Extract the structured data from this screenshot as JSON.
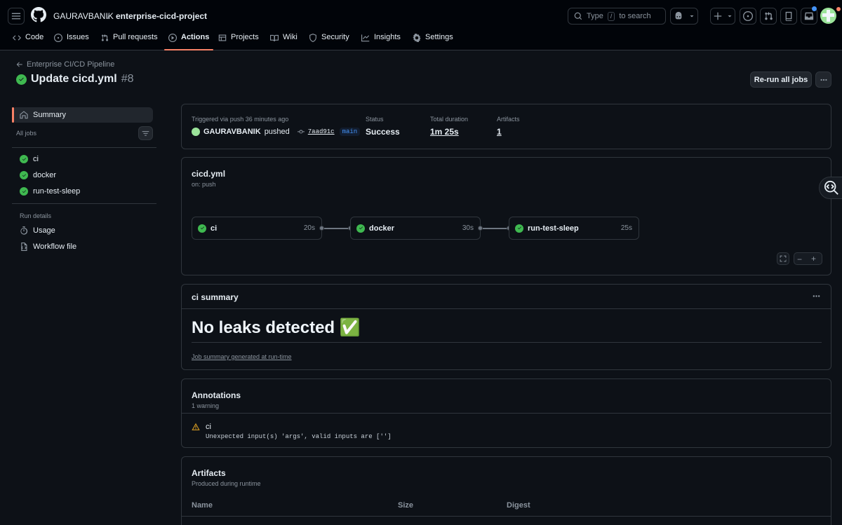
{
  "header": {
    "owner": "GAURAVBANIK",
    "separator": "/",
    "repo": "enterprise-cicd-project",
    "search_type": "Type",
    "search_key": "/",
    "search_rest": "to search"
  },
  "tabs": [
    {
      "label": "Code",
      "icon": "code-icon"
    },
    {
      "label": "Issues",
      "icon": "issue-icon"
    },
    {
      "label": "Pull requests",
      "icon": "pull-request-icon"
    },
    {
      "label": "Actions",
      "icon": "play-icon",
      "active": true
    },
    {
      "label": "Projects",
      "icon": "table-icon"
    },
    {
      "label": "Wiki",
      "icon": "book-icon"
    },
    {
      "label": "Security",
      "icon": "shield-icon"
    },
    {
      "label": "Insights",
      "icon": "graph-icon"
    },
    {
      "label": "Settings",
      "icon": "gear-icon"
    }
  ],
  "run": {
    "back_label": "Enterprise CI/CD Pipeline",
    "title": "Update cicd.yml",
    "number": "#8",
    "rerun_label": "Re-run all jobs"
  },
  "sidebar": {
    "summary_label": "Summary",
    "all_jobs_label": "All jobs",
    "jobs": [
      "ci",
      "docker",
      "run-test-sleep"
    ],
    "run_details_label": "Run details",
    "details": [
      {
        "label": "Usage",
        "icon": "stopwatch-icon"
      },
      {
        "label": "Workflow file",
        "icon": "file-icon"
      }
    ]
  },
  "summary": {
    "trigger_text": "Triggered via push 36 minutes ago",
    "actor": "GAURAVBANIK",
    "action": "pushed",
    "commit": "7aad91c",
    "branch": "main",
    "status_label": "Status",
    "status_value": "Success",
    "duration_label": "Total duration",
    "duration_value": "1m 25s",
    "artifacts_label": "Artifacts",
    "artifacts_value": "1"
  },
  "workflow": {
    "file": "cicd.yml",
    "trigger": "on: push",
    "jobs": [
      {
        "name": "ci",
        "duration": "20s"
      },
      {
        "name": "docker",
        "duration": "30s"
      },
      {
        "name": "run-test-sleep",
        "duration": "25s"
      }
    ]
  },
  "job_summary": {
    "title": "ci summary",
    "heading": "No leaks detected ✅",
    "footer": "Job summary generated at run-time"
  },
  "annotations": {
    "title": "Annotations",
    "subtitle": "1 warning",
    "items": [
      {
        "job": "ci",
        "message": "Unexpected input(s) 'args', valid inputs are ['']"
      }
    ]
  },
  "artifacts": {
    "title": "Artifacts",
    "subtitle": "Produced during runtime",
    "columns": [
      "Name",
      "Size",
      "Digest"
    ]
  },
  "colors": {
    "success": "#3fb950",
    "accent": "#f78166",
    "link": "#4493f8",
    "warning": "#d29922"
  }
}
